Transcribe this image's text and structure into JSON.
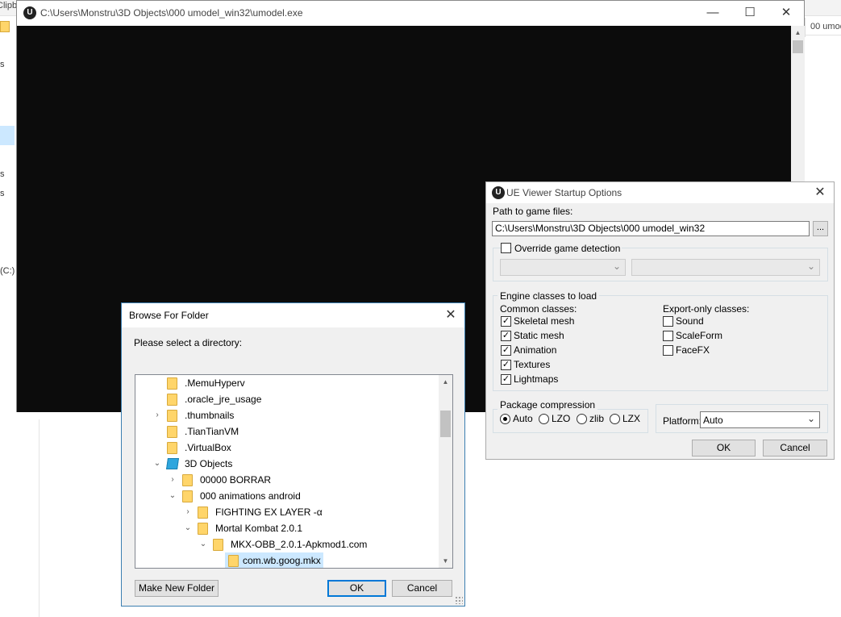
{
  "background": {
    "clip_text": "Clipb",
    "left_fragments": [
      "s",
      "s",
      "s",
      "(C:)"
    ],
    "right_pane_text": "00 umod"
  },
  "console": {
    "title": "C:\\Users\\Monstru\\3D Objects\\000 umodel_win32\\umodel.exe",
    "app_icon": "U",
    "minimize": "—",
    "maximize": "☐",
    "close": "✕"
  },
  "browse": {
    "title": "Browse For Folder",
    "close": "✕",
    "prompt": "Please select a directory:",
    "tree": [
      {
        "label": ".MemuHyperv",
        "indent": 0,
        "expander": ""
      },
      {
        "label": ".oracle_jre_usage",
        "indent": 0,
        "expander": ""
      },
      {
        "label": ".thumbnails",
        "indent": 0,
        "expander": "›"
      },
      {
        "label": ".TianTianVM",
        "indent": 0,
        "expander": ""
      },
      {
        "label": ".VirtualBox",
        "indent": 0,
        "expander": ""
      },
      {
        "label": "3D Objects",
        "indent": 0,
        "expander": "⌄",
        "icon": "3d-objects-icon"
      },
      {
        "label": "00000 BORRAR",
        "indent": 1,
        "expander": "›"
      },
      {
        "label": "000 animations android",
        "indent": 1,
        "expander": "⌄"
      },
      {
        "label": "FIGHTING EX LAYER -α",
        "indent": 2,
        "expander": "›"
      },
      {
        "label": "Mortal Kombat 2.0.1",
        "indent": 2,
        "expander": "⌄"
      },
      {
        "label": "MKX-OBB_2.0.1-Apkmod1.com",
        "indent": 3,
        "expander": "⌄"
      },
      {
        "label": "com.wb.goog.mkx",
        "indent": 4,
        "expander": "",
        "selected": true
      }
    ],
    "make_folder_label": "Make New Folder",
    "ok_label": "OK",
    "cancel_label": "Cancel"
  },
  "ueopt": {
    "title": "UE Viewer Startup Options",
    "app_icon": "U",
    "close": "✕",
    "path_label": "Path to game files:",
    "path_value": "C:\\Users\\Monstru\\3D Objects\\000 umodel_win32",
    "browse_label": "...",
    "override_label": "Override game detection",
    "override_checked": false,
    "engine_classes_label": "Engine classes to load",
    "common_classes_label": "Common classes:",
    "export_classes_label": "Export-only classes:",
    "common_classes": [
      {
        "label": "Skeletal mesh",
        "checked": true
      },
      {
        "label": "Static mesh",
        "checked": true
      },
      {
        "label": "Animation",
        "checked": true
      },
      {
        "label": "Textures",
        "checked": true
      },
      {
        "label": "Lightmaps",
        "checked": true
      }
    ],
    "export_classes": [
      {
        "label": "Sound",
        "checked": false
      },
      {
        "label": "ScaleForm",
        "checked": false
      },
      {
        "label": "FaceFX",
        "checked": false
      }
    ],
    "compression_label": "Package compression",
    "compression_options": [
      {
        "label": "Auto",
        "selected": true
      },
      {
        "label": "LZO",
        "selected": false
      },
      {
        "label": "zlib",
        "selected": false
      },
      {
        "label": "LZX",
        "selected": false
      }
    ],
    "platform_label": "Platform:",
    "platform_value": "Auto",
    "ok_label": "OK",
    "cancel_label": "Cancel"
  }
}
